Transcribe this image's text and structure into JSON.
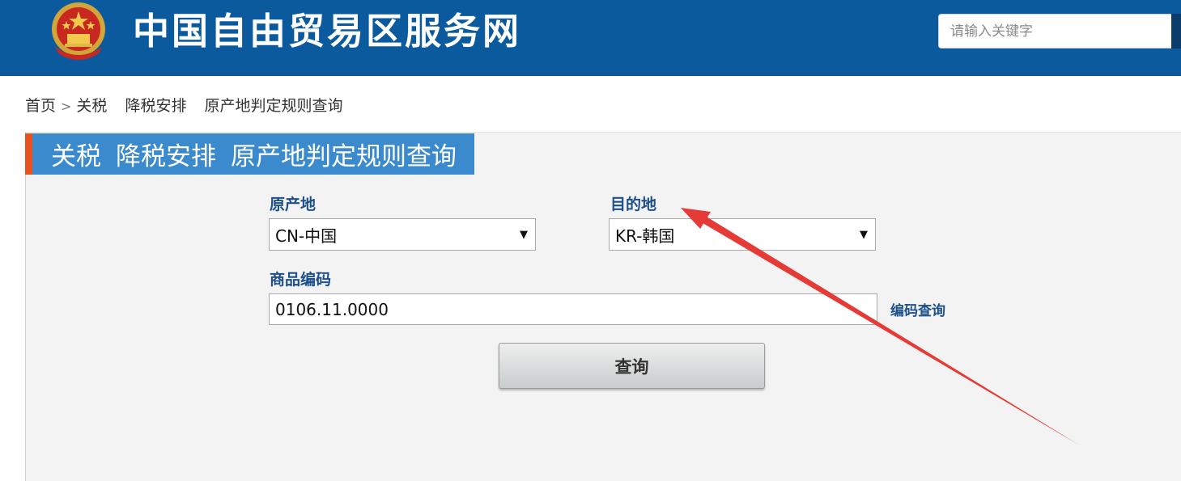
{
  "header": {
    "site_title": "中国自由贸易区服务网",
    "search_placeholder": "请输入关键字",
    "background_color": "#0b5a9e"
  },
  "breadcrumb": {
    "home": "首页",
    "separator": ">",
    "items": [
      "关税",
      "降税安排",
      "原产地判定规则查询"
    ]
  },
  "panel": {
    "heading_parts": [
      "关税",
      "降税安排",
      "原产地判定规则查询"
    ],
    "accent_color": "#3a8acd",
    "edge_color": "#e8521e"
  },
  "form": {
    "origin_label": "原产地",
    "origin_value": "CN-中国",
    "destination_label": "目的地",
    "destination_value": "KR-韩国",
    "code_label": "商品编码",
    "code_value": "0106.11.0000",
    "code_lookup_link": "编码查询",
    "submit_label": "查询",
    "dropdown_arrow_icon": "triangle-down-icon"
  },
  "annotation": {
    "icon": "red-arrow-annotation",
    "color": "#e53a35"
  }
}
